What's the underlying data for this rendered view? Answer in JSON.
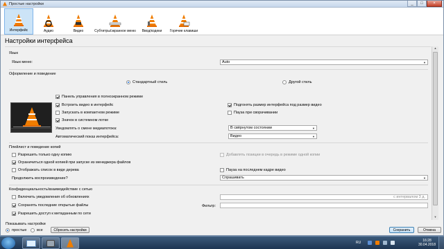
{
  "window": {
    "title": "Простые настройки"
  },
  "toolbar": {
    "items": [
      {
        "label": "Интерфейс",
        "active": true
      },
      {
        "label": "Аудио"
      },
      {
        "label": "Видео"
      },
      {
        "label": "Субтитры/экранное меню"
      },
      {
        "label": "Ввод/кодеки"
      },
      {
        "label": "Горячие клавиши"
      }
    ]
  },
  "page_title": "Настройки интерфейса",
  "language": {
    "section": "Язык",
    "menu_label": "Язык меню:",
    "menu_value": "Auto"
  },
  "look": {
    "section": "Оформление и поведение",
    "style_standard": "Стандартный стиль",
    "style_other": "Другой стиль",
    "cb_fullscreen_controls": "Панель управления в полноэкранном режиме",
    "cb_embed_video": "Встроить видео в интерфейс",
    "cb_resize_interface": "Подгонять размер интерфейса под размер видео",
    "cb_start_minimal": "Запускать в компактном режиме",
    "cb_pause_minimized": "Пауза при сворачивании",
    "cb_systray": "Значок в системном лотке",
    "notify_label": "Уведомлять о смене медиапотока:",
    "notify_value": "В свёрнутом состоянии",
    "autoraise_label": "Автоматический показ интерфейса:",
    "autoraise_value": "Видео"
  },
  "playlist": {
    "section": "Плейлист и поведение копий",
    "cb_one_instance": "Разрешить только одну копию",
    "cb_enqueue": "Добавлять позиции в очередь в режиме одной копии",
    "cb_one_instance_fm": "Ограничиться одной копией при запуске из менеджера файлов",
    "cb_tree": "Отображать список в виде дерева",
    "cb_pause_last": "Пауза на последнем кадре видео",
    "continue_label": "Продолжить воспроизведение?",
    "continue_value": "Спрашивать"
  },
  "privacy": {
    "section": "Конфиденциальность/взаимодействие с сетью",
    "cb_updates": "Включить уведомления об обновлениях",
    "update_interval_placeholder": "с интервалом 3 д.",
    "cb_recent": "Сохранять последние открытые файлы",
    "filter_label": "Фильтр:",
    "cb_metadata": "Разрешить доступ к метаданным по сети"
  },
  "footer": {
    "show_label": "Показывать настройки",
    "radio_simple": "простые",
    "radio_all": "все",
    "reset_button": "Сбросить настройки",
    "save_button": "Сохранить",
    "cancel_button": "Отмена"
  },
  "taskbar": {
    "lang": "RU",
    "time": "16:28",
    "date": "30.04.2018"
  },
  "colors": {
    "accent": "#1c6fd8",
    "vlc_orange": "#f07d00"
  }
}
